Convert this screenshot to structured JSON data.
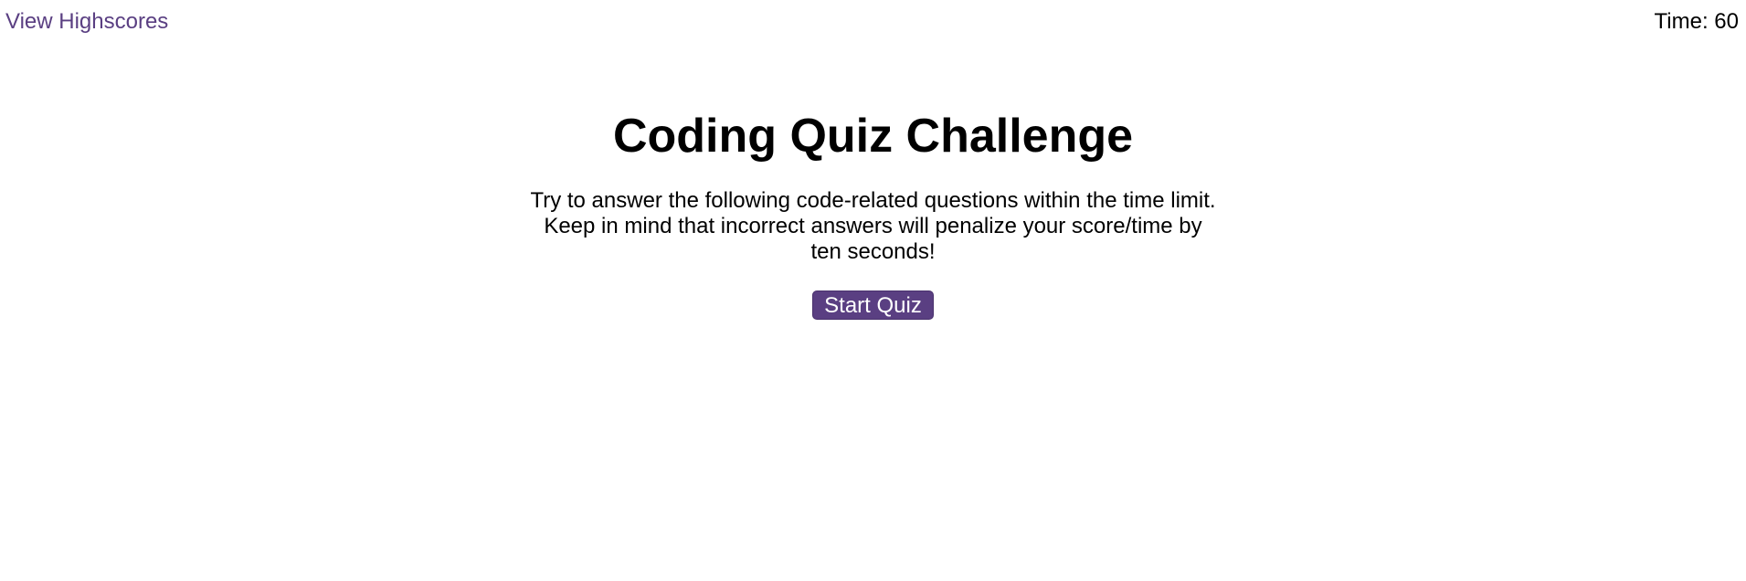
{
  "header": {
    "highscores_label": "View Highscores",
    "timer_text": "Time: 60"
  },
  "main": {
    "title": "Coding Quiz Challenge",
    "instructions": "Try to answer the following code-related questions within the time limit. Keep in mind that incorrect answers will penalize your score/time by ten seconds!",
    "start_label": "Start Quiz"
  },
  "colors": {
    "accent": "#5a3f82",
    "background": "#ffffff",
    "text": "#000000"
  }
}
